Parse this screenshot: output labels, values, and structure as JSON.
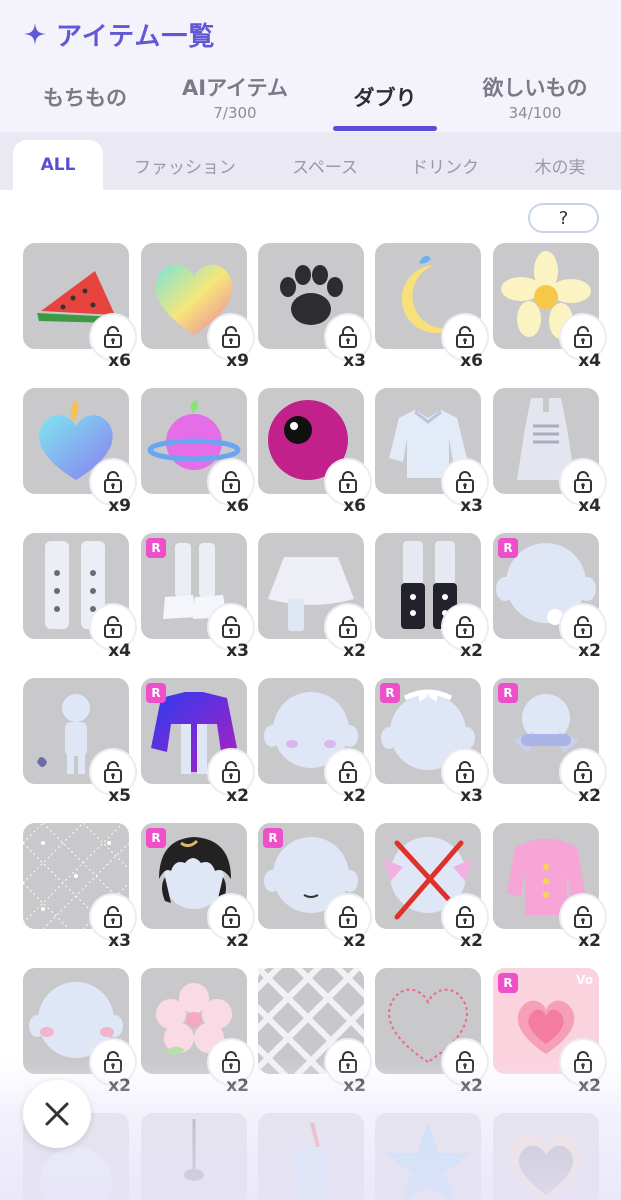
{
  "header": {
    "title": "アイテム一覧",
    "icon": "sparkle-icon",
    "accent_color": "#6258d6"
  },
  "tabs": [
    {
      "label": "もちもの",
      "count": ""
    },
    {
      "label": "AIアイテム",
      "count": "7/300"
    },
    {
      "label": "ダブり",
      "count": "",
      "active": true
    },
    {
      "label": "欲しいもの",
      "count": "34/100"
    }
  ],
  "categories": [
    {
      "label": "ALL",
      "active": true
    },
    {
      "label": "ファッション"
    },
    {
      "label": "スペース"
    },
    {
      "label": "ドリンク"
    },
    {
      "label": "木の実"
    }
  ],
  "help_label": "?",
  "items": [
    {
      "name": "watermelon",
      "qty": "x6"
    },
    {
      "name": "rainbow-heart",
      "qty": "x9"
    },
    {
      "name": "paw-print",
      "qty": "x3"
    },
    {
      "name": "crescent-moon",
      "qty": "x6"
    },
    {
      "name": "plumeria-flower",
      "qty": "x4"
    },
    {
      "name": "pastel-heart-fruit",
      "qty": "x9"
    },
    {
      "name": "ringed-planet",
      "qty": "x6"
    },
    {
      "name": "magenta-eyeball",
      "qty": "x6"
    },
    {
      "name": "frill-blouse",
      "qty": "x3"
    },
    {
      "name": "ribbed-tank-top",
      "qty": "x4"
    },
    {
      "name": "skull-leg-warmers",
      "qty": "x4"
    },
    {
      "name": "white-sneakers",
      "qty": "x3",
      "rare": "R"
    },
    {
      "name": "tulle-skirt",
      "qty": "x2"
    },
    {
      "name": "black-skull-leg-warmers",
      "qty": "x2"
    },
    {
      "name": "flower-hair-clip",
      "qty": "x2",
      "rare": "R"
    },
    {
      "name": "ghost-companion",
      "qty": "x5"
    },
    {
      "name": "galaxy-jacket",
      "qty": "x2",
      "rare": "R"
    },
    {
      "name": "blush-face",
      "qty": "x2"
    },
    {
      "name": "ribbon-headband",
      "qty": "x3",
      "rare": "R"
    },
    {
      "name": "side-ribbons",
      "qty": "x2",
      "rare": "R"
    },
    {
      "name": "diamond-pattern-tights",
      "qty": "x3"
    },
    {
      "name": "black-hair",
      "qty": "x2",
      "rare": "R"
    },
    {
      "name": "smile-face",
      "qty": "x2",
      "rare": "R"
    },
    {
      "name": "crossed-out-ribbons",
      "qty": "x2"
    },
    {
      "name": "pink-cardigan",
      "qty": "x2"
    },
    {
      "name": "rosy-cheeks",
      "qty": "x2"
    },
    {
      "name": "cherry-blossom",
      "qty": "x2"
    },
    {
      "name": "lattice-background",
      "qty": "x2"
    },
    {
      "name": "dotted-heart-frame",
      "qty": "x2"
    },
    {
      "name": "pink-heart-wallpaper",
      "qty": "x2",
      "rare": "R",
      "corner": "Vo"
    },
    {
      "name": "partial-head",
      "qty": ""
    },
    {
      "name": "pendulum",
      "qty": ""
    },
    {
      "name": "drink-cup",
      "qty": ""
    },
    {
      "name": "blue-star",
      "qty": ""
    },
    {
      "name": "heart-mirror",
      "qty": ""
    }
  ],
  "close_icon": "close-icon"
}
